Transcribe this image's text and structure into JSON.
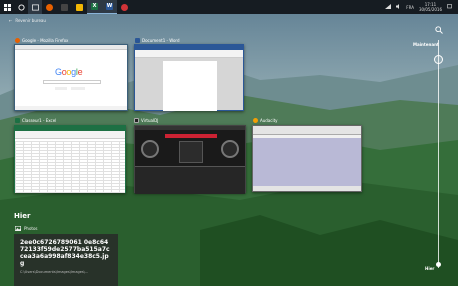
{
  "taskbar": {
    "apps": [
      {
        "name": "firefox",
        "color": "#e66000",
        "letter": ""
      },
      {
        "name": "cmd",
        "color": "#333",
        "letter": ""
      },
      {
        "name": "files",
        "color": "#f2b705",
        "letter": ""
      },
      {
        "name": "excel",
        "color": "#1d7044",
        "letter": "X"
      },
      {
        "name": "word",
        "color": "#2b5797",
        "letter": "W"
      },
      {
        "name": "music",
        "color": "#d13438",
        "letter": ""
      }
    ],
    "tray": {
      "lang": "FRA",
      "time": "17:11",
      "date": "30/05/2016"
    }
  },
  "back_link": "Revenir bureau",
  "windows": {
    "firefox": {
      "title": "Google - Mozilla Firefox",
      "logo": "Google"
    },
    "word": {
      "title": "Document1 - Word"
    },
    "excel": {
      "title": "Classeur1 - Excel"
    },
    "virtualdj": {
      "title": "VirtualDJ"
    },
    "audacity": {
      "title": "Audacity"
    }
  },
  "timeline": {
    "top_label": "Maintenant",
    "bottom_label": "Hier"
  },
  "section": {
    "title": "Hier",
    "app_label": "Photos",
    "photo_name": "2ee0c6726789061 0e8c6472133f59de2577ba515a7ccea3a6a998af834e38c5.jpg",
    "photo_path": "C:\\Users\\Documents\\Images\\Images\\..."
  }
}
